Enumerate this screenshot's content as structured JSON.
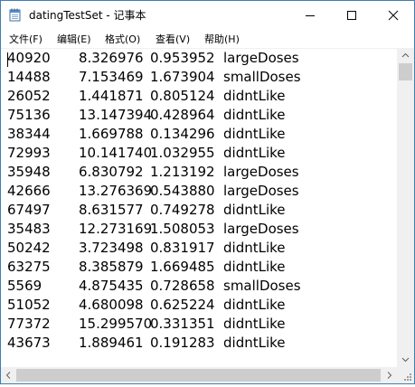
{
  "window": {
    "title": "datingTestSet - 记事本"
  },
  "menubar": {
    "items": [
      {
        "label": "文件(F)"
      },
      {
        "label": "编辑(E)"
      },
      {
        "label": "格式(O)"
      },
      {
        "label": "查看(V)"
      },
      {
        "label": "帮助(H)"
      }
    ]
  },
  "content": {
    "rows": [
      {
        "c1": "40920",
        "c2": "8.326976",
        "c3": "0.953952",
        "c4": "largeDoses"
      },
      {
        "c1": "14488",
        "c2": "7.153469",
        "c3": "1.673904",
        "c4": "smallDoses"
      },
      {
        "c1": "26052",
        "c2": "1.441871",
        "c3": "0.805124",
        "c4": "didntLike"
      },
      {
        "c1": "75136",
        "c2": "13.147394",
        "c3": "0.428964",
        "c4": "didntLike"
      },
      {
        "c1": "38344",
        "c2": "1.669788",
        "c3": "0.134296",
        "c4": "didntLike"
      },
      {
        "c1": "72993",
        "c2": "10.141740",
        "c3": "1.032955",
        "c4": "didntLike"
      },
      {
        "c1": "35948",
        "c2": "6.830792",
        "c3": "1.213192",
        "c4": "largeDoses"
      },
      {
        "c1": "42666",
        "c2": "13.276369",
        "c3": "0.543880",
        "c4": "largeDoses"
      },
      {
        "c1": "67497",
        "c2": "8.631577",
        "c3": "0.749278",
        "c4": "didntLike"
      },
      {
        "c1": "35483",
        "c2": "12.273169",
        "c3": "1.508053",
        "c4": "largeDoses"
      },
      {
        "c1": "50242",
        "c2": "3.723498",
        "c3": "0.831917",
        "c4": "didntLike"
      },
      {
        "c1": "63275",
        "c2": "8.385879",
        "c3": "1.669485",
        "c4": "didntLike"
      },
      {
        "c1": "5569",
        "c2": "4.875435",
        "c3": "0.728658",
        "c4": "smallDoses"
      },
      {
        "c1": "51052",
        "c2": "4.680098",
        "c3": "0.625224",
        "c4": "didntLike"
      },
      {
        "c1": "77372",
        "c2": "15.299570",
        "c3": "0.331351",
        "c4": "didntLike"
      },
      {
        "c1": "43673",
        "c2": "1.889461",
        "c3": "0.191283",
        "c4": "didntLike"
      }
    ]
  },
  "icons": {
    "app": "notepad-icon",
    "minimize": "minimize-icon",
    "maximize": "maximize-icon",
    "close": "close-icon"
  },
  "colors": {
    "window_border": "#3c7fb1",
    "scrollbar_track": "#f0f0f0",
    "scrollbar_thumb": "#cdcdcd"
  }
}
